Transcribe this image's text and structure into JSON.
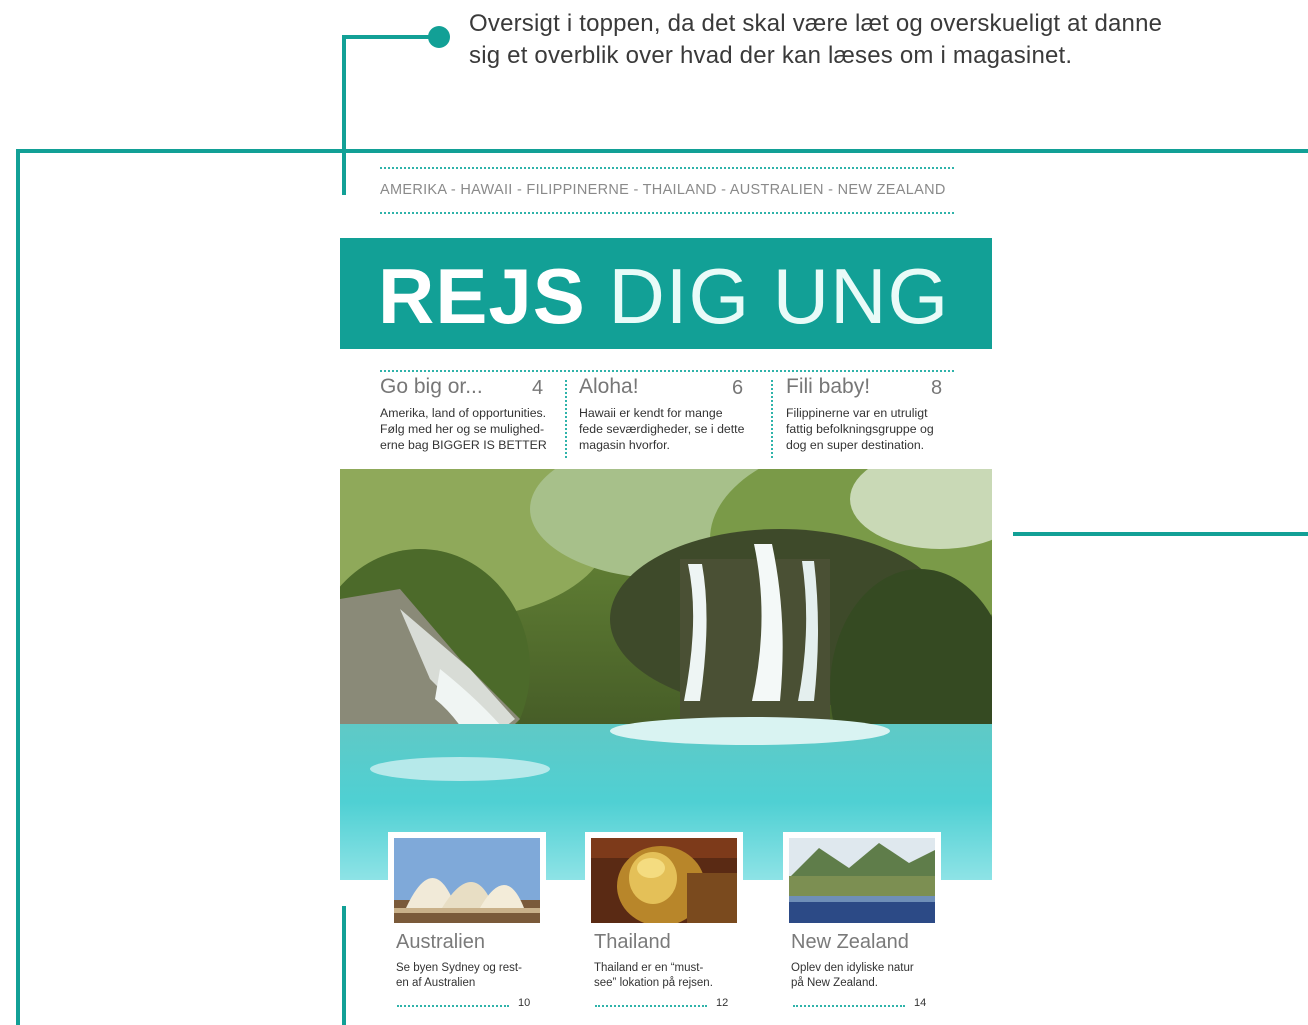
{
  "annotation": {
    "line1": "Oversigt i toppen, da det skal være læt og overskueligt at danne",
    "line2": "sig et overblik over hvad der kan læses om i magasinet."
  },
  "nav": {
    "destinations": "AMERIKA - HAWAII - FILIPPINERNE - THAILAND - AUSTRALIEN - NEW ZEALAND"
  },
  "banner": {
    "title_bold": "REJS",
    "title_light": "DIG UNG"
  },
  "contents": [
    {
      "heading": "Go big or...",
      "page": "4",
      "lines": [
        "Amerika, land of opportunities.",
        "Følg med her og se mulighed-",
        "erne bag BIGGER IS BETTER"
      ]
    },
    {
      "heading": "Aloha!",
      "page": "6",
      "lines": [
        "Hawaii er kendt for mange",
        "fede seværdigheder, se i dette",
        "magasin hvorfor."
      ]
    },
    {
      "heading": "Fili baby!",
      "page": "8",
      "lines": [
        "Filippinerne var en utruligt",
        "fattig befolkningsgruppe og",
        "dog en super destination."
      ]
    }
  ],
  "cards": [
    {
      "title": "Australien",
      "lines": [
        "Se byen Sydney og rest-",
        "en af Australien"
      ],
      "page": "10"
    },
    {
      "title": "Thailand",
      "lines": [
        "Thailand er en “must-",
        "see” lokation på rejsen."
      ],
      "page": "12"
    },
    {
      "title": "New Zealand",
      "lines": [
        "Oplev den idyliske natur",
        "på New Zealand."
      ],
      "page": "14"
    }
  ],
  "colors": {
    "accent": "#12a096",
    "water": "#4fd0d3",
    "text": "#333333"
  }
}
